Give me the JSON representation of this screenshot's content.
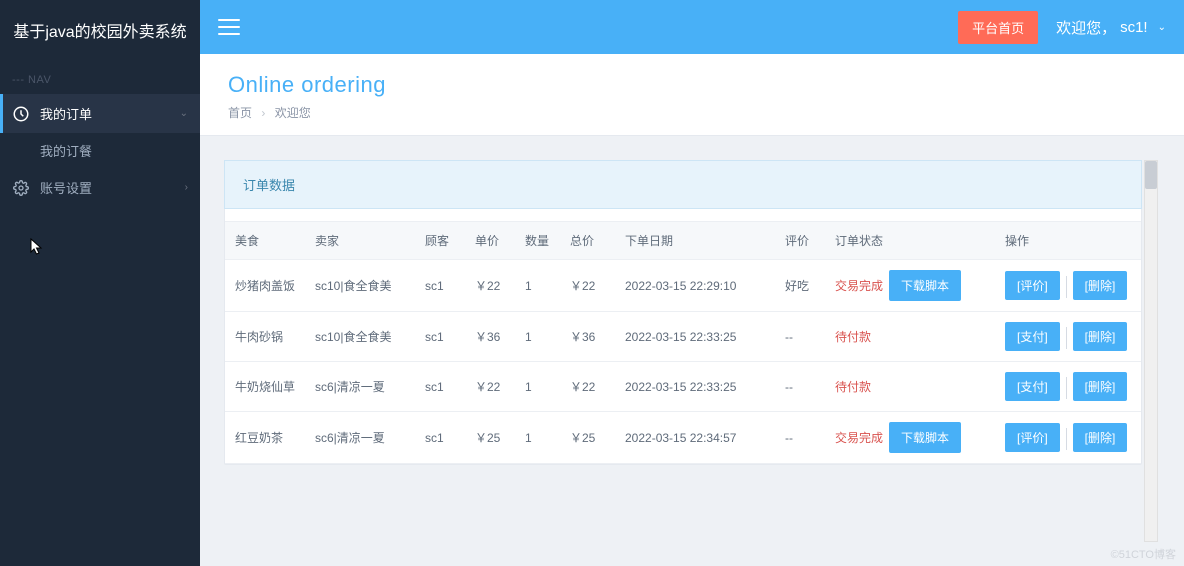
{
  "app": {
    "title": "基于java的校园外卖系统",
    "nav_label": "--- NAV"
  },
  "sidebar": {
    "items": [
      {
        "label": "我的订单",
        "icon": "dashboard-icon",
        "expanded": true,
        "sub": [
          {
            "label": "我的订餐"
          }
        ]
      },
      {
        "label": "账号设置",
        "icon": "gear-icon",
        "expanded": false
      }
    ]
  },
  "topbar": {
    "platform_btn": "平台首页",
    "welcome_prefix": "欢迎您，",
    "username": "sc1!"
  },
  "page": {
    "title": "Online ordering",
    "breadcrumb": [
      "首页",
      "欢迎您"
    ]
  },
  "panel": {
    "title": "订单数据"
  },
  "table": {
    "headers": [
      "美食",
      "卖家",
      "顾客",
      "单价",
      "数量",
      "总价",
      "下单日期",
      "评价",
      "订单状态",
      "操作"
    ],
    "rows": [
      {
        "food": "炒猪肉盖饭",
        "seller": "sc10|食全食美",
        "customer": "sc1",
        "price": "￥22",
        "qty": "1",
        "total": "￥22",
        "date": "2022-03-15 22:29:10",
        "review": "好吃",
        "status": "交易完成",
        "status_type": "done",
        "script_btn": "下载脚本",
        "ops": [
          "[评价]",
          "[删除]"
        ]
      },
      {
        "food": "牛肉砂锅",
        "seller": "sc10|食全食美",
        "customer": "sc1",
        "price": "￥36",
        "qty": "1",
        "total": "￥36",
        "date": "2022-03-15 22:33:25",
        "review": "--",
        "status": "待付款",
        "status_type": "pending",
        "ops": [
          "[支付]",
          "[删除]"
        ]
      },
      {
        "food": "牛奶烧仙草",
        "seller": "sc6|清凉一夏",
        "customer": "sc1",
        "price": "￥22",
        "qty": "1",
        "total": "￥22",
        "date": "2022-03-15 22:33:25",
        "review": "--",
        "status": "待付款",
        "status_type": "pending",
        "ops": [
          "[支付]",
          "[删除]"
        ]
      },
      {
        "food": "红豆奶茶",
        "seller": "sc6|清凉一夏",
        "customer": "sc1",
        "price": "￥25",
        "qty": "1",
        "total": "￥25",
        "date": "2022-03-15 22:34:57",
        "review": "--",
        "status": "交易完成",
        "status_type": "done",
        "script_btn": "下载脚本",
        "ops": [
          "[评价]",
          "[删除]"
        ]
      }
    ]
  },
  "watermark": "©51CTO博客"
}
